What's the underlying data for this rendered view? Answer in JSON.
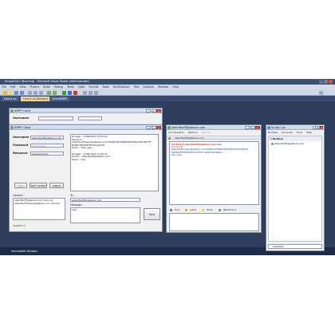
{
  "ide": {
    "title": "XmppClient (Running) - Microsoft Visual Studio (Administrator)",
    "window_buttons": [
      "_",
      "□",
      "x"
    ],
    "menu": [
      "File",
      "Edit",
      "View",
      "Project",
      "Build",
      "Debug",
      "Team",
      "Data",
      "Format",
      "Tools",
      "Architecture",
      "Test",
      "Analyze",
      "Window",
      "Help"
    ],
    "tabs": [
      "Form1.cs",
      "Form1.cs [Design]",
      "ClientXMPP"
    ],
    "status": "Immediate Window"
  },
  "back_window": {
    "title": "XMPP Client",
    "username_label": "Username"
  },
  "client": {
    "title": "XMPP Client",
    "username_label": "Username",
    "username_value": "albertfeoff@jabbere.com",
    "password_label": "Password",
    "password_value": "••••••••••",
    "resource_label": "Resource",
    "resource_value": "serpententize",
    "log": [
      "Tanggal : 17/09/2010 14:56:20",
      "Pengirim :",
      "albertfeoffnewer@jabbere.com/4C65C2634665F665296C2F0C9E7F8",
      "B4E8C1EF9F0F8D35C2C1F8",
      "Pesan : Halo juga",
      "",
      "Tanggal : 17/09/2010 14:56:27",
      "Tujuan : albertfeoff@jabbere.com",
      "Pesan : halo"
    ],
    "login_button": "Login",
    "add_contact_button": "Add Contact",
    "logout_button": "Logout",
    "contact_label": "Contact :",
    "contacts": [
      "albertfeoff@jabbere.com (Online)",
      "albertfeoffnewer@jabbere.com (Online)"
    ],
    "to_label": "To :",
    "to_value": "albertfeoff@jabbere.com",
    "message_label": "Message :",
    "message_value": "halo",
    "send_button": "Send",
    "status_text": "Logged In"
  },
  "chat": {
    "title": "albertfeoff@jabbere.com",
    "menu": [
      "Conversation",
      "Options",
      "Send To"
    ],
    "contact_line": "albertfeoff@jabbere.com",
    "log": {
      "sender": "[14:56:27] albertfeoff@jabbere.com",
      "sender_msg": "halo",
      "stamp": "[14:56:29]",
      "reply_from": "albertfeoffnewer@jabbere.com/4C65C2634665F665296C2F0C9E7F8",
      "reply_id": "B4E8C1EF9F0F8D35C2C1F8 (4C65C2634665...)",
      "reply_text": "Halo juga"
    },
    "tools": [
      "Font",
      "Insert",
      "Smile",
      "Attachment"
    ],
    "send_button": "Send"
  },
  "roster": {
    "title": "Buddy List",
    "menu": [
      "Buddies",
      "Accounts",
      "Tools",
      "Help"
    ],
    "group": "Buddies",
    "buddies": [
      "albertfeoff@jabbere.com"
    ],
    "status": "Available"
  },
  "colors": {
    "ide_frame": "#2e3e5c",
    "accent_tab": "#f4d89a",
    "online": "#6aa845",
    "chat_sender": "#d23a1e",
    "chat_text": "#1b3fa0"
  }
}
